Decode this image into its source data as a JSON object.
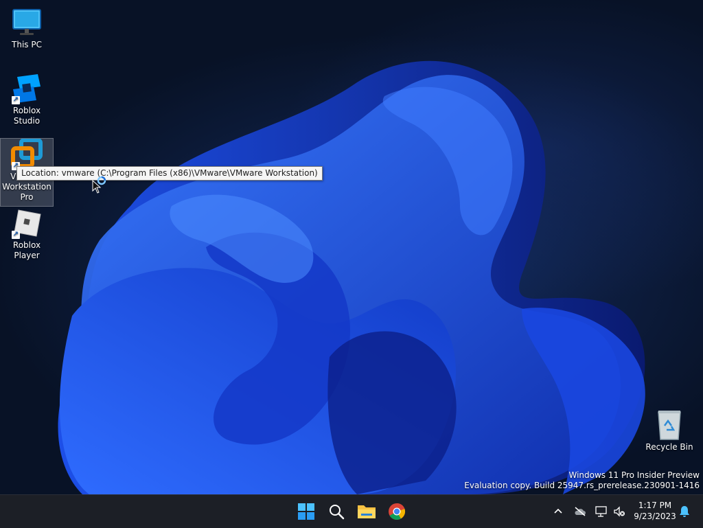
{
  "desktop": {
    "icons": [
      {
        "label": "This PC",
        "icon": "monitor-icon"
      },
      {
        "label": "Roblox Studio",
        "icon": "roblox-studio-icon"
      },
      {
        "label": "VMware Workstation Pro",
        "label_lines": [
          "VMware",
          "Workstation",
          "Pro"
        ],
        "icon": "vmware-icon"
      },
      {
        "label": "Roblox Player",
        "icon": "roblox-player-icon"
      },
      {
        "label": "Recycle Bin",
        "icon": "recycle-bin-icon"
      }
    ],
    "tooltip": "Location: vmware (C:\\Program Files (x86)\\VMware\\VMware Workstation)",
    "watermark": {
      "line1": "Windows 11 Pro Insider Preview",
      "line2": "Evaluation copy. Build 25947.rs_prerelease.230901-1416"
    }
  },
  "taskbar": {
    "apps": [
      {
        "name": "Start",
        "icon": "windows-start-icon"
      },
      {
        "name": "Search",
        "icon": "search-icon"
      },
      {
        "name": "File Explorer",
        "icon": "folder-icon"
      },
      {
        "name": "Google Chrome",
        "icon": "chrome-icon"
      }
    ],
    "tray": {
      "icons": [
        "chevron-up-icon",
        "onedrive-offline-icon",
        "network-icon",
        "volume-muted-icon",
        "notification-bell-icon"
      ],
      "time": "1:17 PM",
      "date": "9/23/2023"
    }
  },
  "colors": {
    "taskbar_bg": "#1c1f26",
    "accent": "#2a6fe0"
  }
}
